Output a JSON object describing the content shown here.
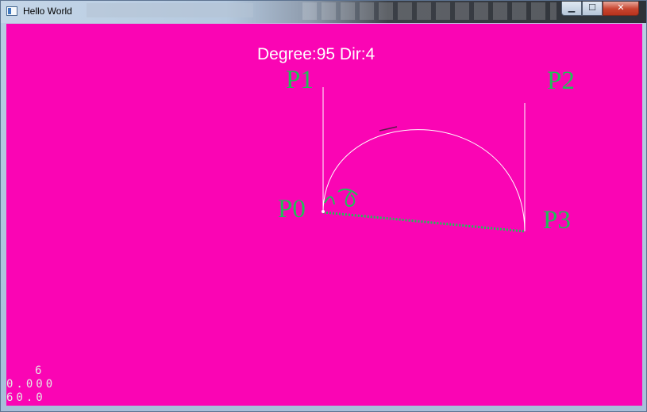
{
  "window": {
    "title": "Hello World",
    "controls": {
      "minimize": "▁",
      "maximize": "☐",
      "close": "✕"
    }
  },
  "scene": {
    "background_color": "#fa05b4",
    "hud": {
      "degree_text": "Degree:95 Dir:4"
    },
    "points": {
      "p0": "P0",
      "p1": "P1",
      "p2": "P2",
      "p3": "P3"
    },
    "label_color": "#1fbf58",
    "stats": {
      "line1": "6",
      "line2": "0.000",
      "line3": "60.0"
    }
  }
}
